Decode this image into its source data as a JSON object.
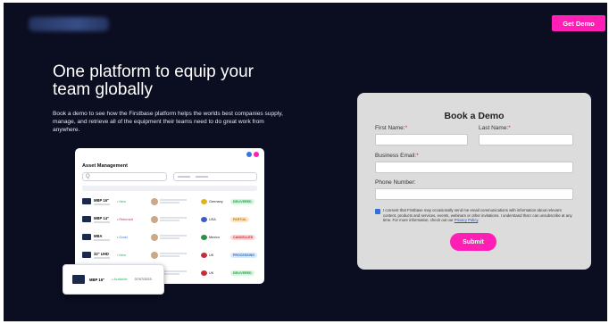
{
  "header": {
    "get_demo_label": "Get Demo"
  },
  "hero": {
    "headline": "One platform to equip your team globally",
    "subcopy": "Book a demo to see how the Firstbase platform helps the worlds best companies supply, manage, and retrieve all of the equipment their teams need to do great work from anywhere."
  },
  "dashboard": {
    "title": "Asset Management",
    "search_icon": "Q",
    "rows": [
      {
        "model": "MBP 16\"",
        "status": "• New",
        "status_color": "#2bb75a",
        "country": "Germany",
        "flag": "#e3b21b",
        "badge": "DELIVERED",
        "badge_bg": "#d9f5df",
        "badge_color": "#1f9a43"
      },
      {
        "model": "MBP 14\"",
        "status": "• Returned",
        "status_color": "#e0245e",
        "country": "USA",
        "flag": "#3b5bc8",
        "badge": "PARTIAL",
        "badge_bg": "#fde8c6",
        "badge_color": "#c2731a"
      },
      {
        "model": "MBA",
        "status": "• Good",
        "status_color": "#3a74e3",
        "country": "Mexico",
        "flag": "#2e8f47",
        "badge": "CANCELLED",
        "badge_bg": "#fbdada",
        "badge_color": "#c22a2a"
      },
      {
        "model": "32\" UHD",
        "status": "• New",
        "status_color": "#2bb75a",
        "country": "UK",
        "flag": "#c62c3a",
        "badge": "PROCESSING",
        "badge_bg": "#d8e9fb",
        "badge_color": "#2a6cc2"
      },
      {
        "model": "",
        "status": "",
        "status_color": "#2bb75a",
        "country": "UK",
        "flag": "#c62c3a",
        "badge": "DELIVERED",
        "badge_bg": "#d9f5df",
        "badge_color": "#1f9a43"
      }
    ],
    "popup": {
      "model": "MBP 16\"",
      "status": "• Available",
      "date": "07/07/2023"
    }
  },
  "form": {
    "title": "Book a Demo",
    "first_name_label": "First Name:",
    "last_name_label": "Last Name:",
    "email_label": "Business Email:",
    "phone_label": "Phone Number:",
    "required_mark": "*",
    "consent_text": "I consent that Firstbase may occasionally send me email communications with information about relevant content, products and services, events, webinars or other invitations. I understand that I can unsubscribe at any time. For more information, check out our ",
    "privacy_link": "Privacy Policy",
    "consent_end": ".",
    "submit_label": "Submit"
  },
  "colors": {
    "background": "#0b0d21",
    "accent": "#ff1fb4",
    "card": "#dcdcdc"
  }
}
